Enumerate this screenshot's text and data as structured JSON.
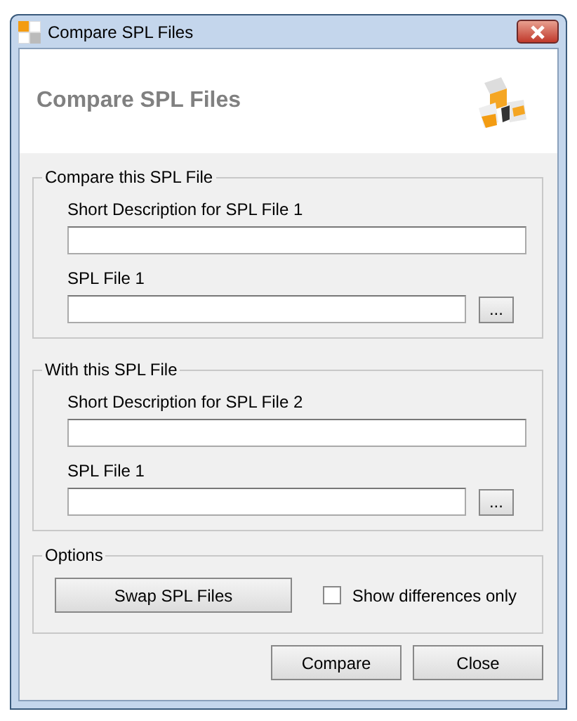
{
  "window": {
    "title": "Compare SPL Files"
  },
  "header": {
    "title": "Compare SPL Files"
  },
  "groups": [
    {
      "legend": "Compare this SPL File",
      "description_label": "Short Description for SPL File 1",
      "file_label": "SPL File 1",
      "browse_button": "..."
    },
    {
      "legend": "With this SPL File",
      "description_label": "Short Description for SPL File 2",
      "file_label": "SPL File 1",
      "browse_button": "..."
    }
  ],
  "options": {
    "legend": "Options",
    "swap_button": "Swap SPL Files",
    "checkbox": {
      "label": "Show differences only",
      "checked": false
    }
  },
  "buttons": [
    "Compare",
    "Close"
  ]
}
